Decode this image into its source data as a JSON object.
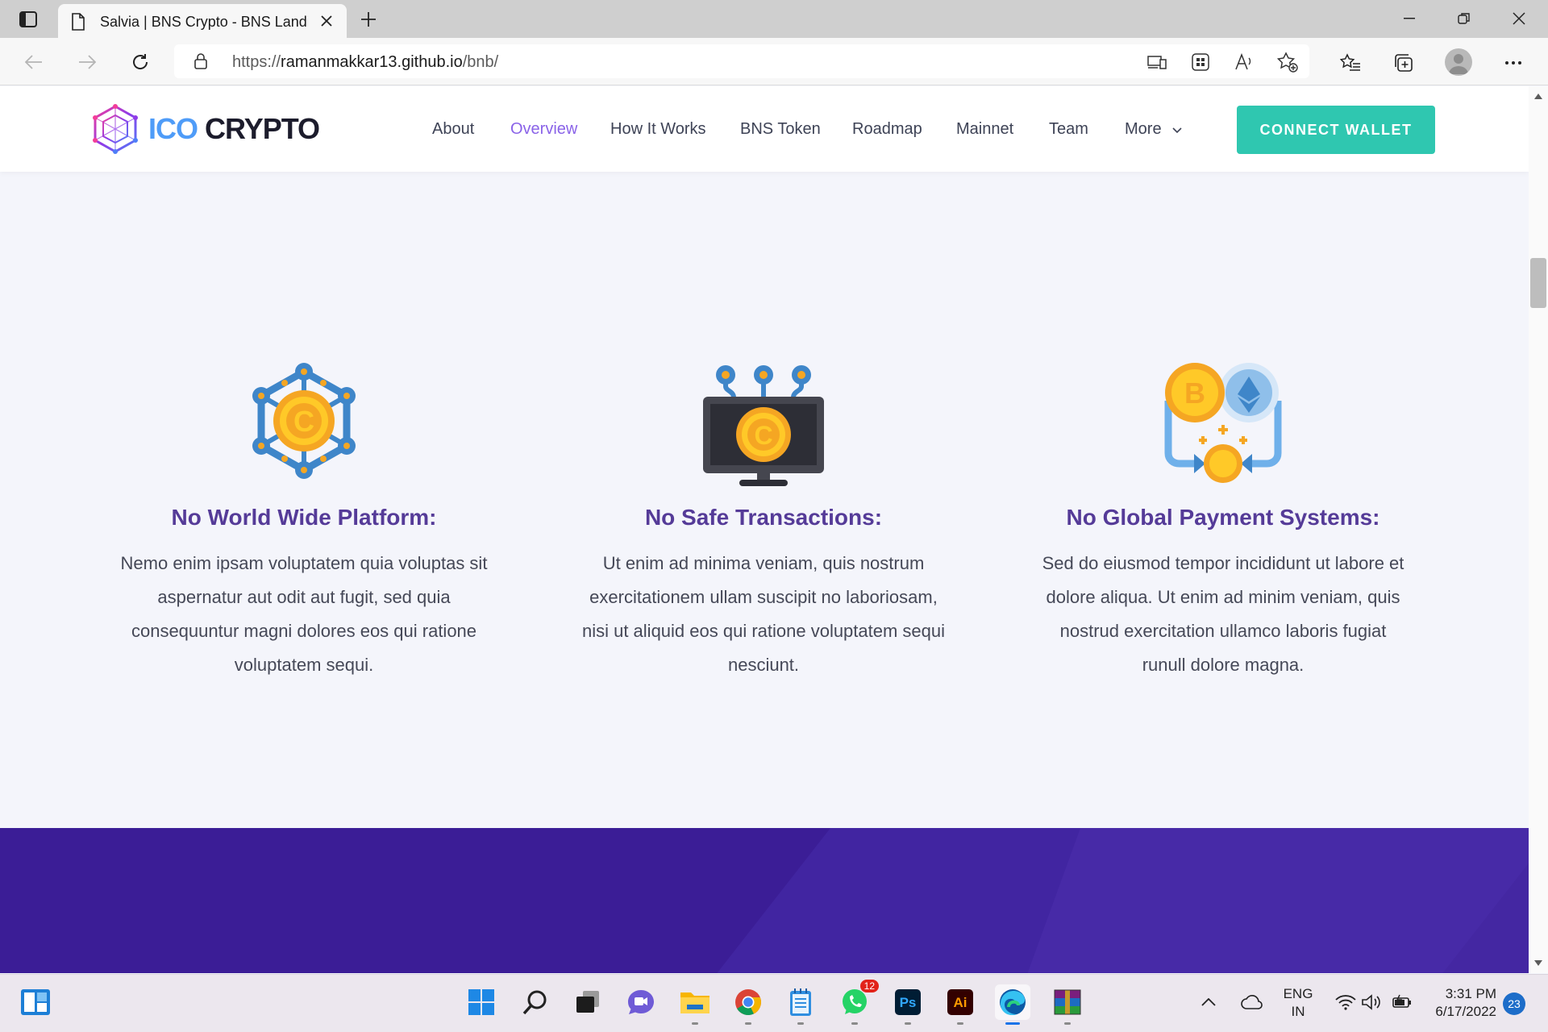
{
  "browser": {
    "tab_title": "Salvia | BNS Crypto - BNS Landing",
    "url_prefix": "https://",
    "url_host": "ramanmakkar13.github.io",
    "url_path": "/bnb/"
  },
  "site": {
    "logo_ico": "ICO",
    "logo_crypto": "CRYPTO",
    "menu": [
      {
        "label": "About"
      },
      {
        "label": "Overview"
      },
      {
        "label": "How It Works"
      },
      {
        "label": "BNS Token"
      },
      {
        "label": "Roadmap"
      },
      {
        "label": "Mainnet"
      },
      {
        "label": "Team"
      },
      {
        "label": "More"
      }
    ],
    "connect_label": "CONNECT WALLET",
    "colors": {
      "accent": "#2fc7b0",
      "heading": "#553b98",
      "active_menu": "#8a63e8",
      "band": "#3b1d96"
    }
  },
  "features": [
    {
      "icon": "blockchain-coin-icon",
      "title": "No World Wide Platform:",
      "text": "Nemo enim ipsam voluptatem quia voluptas sit aspernatur aut odit aut fugit, sed quia consequuntur magni dolores eos qui ratione voluptatem sequi."
    },
    {
      "icon": "monitor-coin-icon",
      "title": "No Safe Transactions:",
      "text": "Ut enim ad minima veniam, quis nostrum exercitationem ullam suscipit no laboriosam, nisi ut aliquid eos qui ratione voluptatem sequi nesciunt."
    },
    {
      "icon": "crypto-exchange-icon",
      "title": "No Global Payment Systems:",
      "text": "Sed do eiusmod tempor incididunt ut labore et dolore aliqua. Ut enim ad minim veniam, quis nostrud exercitation ullamco laboris fugiat runull dolore magna."
    }
  ],
  "taskbar": {
    "whatsapp_badge": "12",
    "lang_top": "ENG",
    "lang_bottom": "IN",
    "time": "3:31 PM",
    "date": "6/17/2022",
    "notifications": "23"
  }
}
